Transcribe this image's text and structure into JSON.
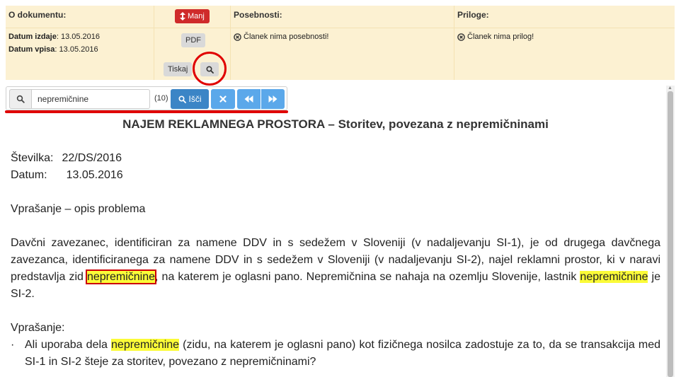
{
  "meta": {
    "about": {
      "header": "O dokumentu:",
      "issued_label": "Datum izdaje",
      "issued_value": ": 13.05.2016",
      "entered_label": "Datum vpisa",
      "entered_value": ": 13.05.2016"
    },
    "actions": {
      "less_label": "Manj",
      "pdf_label": "PDF",
      "print_label": "Tiskaj"
    },
    "specialties": {
      "header": "Posebnosti:",
      "text": "Članek nima posebnosti!"
    },
    "attachments": {
      "header": "Priloge:",
      "text": "Članek nima prilog!"
    }
  },
  "search": {
    "value": "nepremičnine",
    "count": "(10)",
    "search_label": "Išči"
  },
  "document": {
    "title": "NAJEM REKLAMNEGA PROSTORA – Storitev, povezana z nepremičninami",
    "number_label": "Številka:",
    "number_value": "22/DS/2016",
    "date_label": "Datum:",
    "date_value": "13.05.2016",
    "problem_heading": "Vprašanje – opis problema",
    "p1_part1": "Davčni zavezanec, identificiran za namene DDV in s sedežem v Sloveniji (v nadaljevanju SI-1), je od drugega davčnega zavezanca, identificiranega za namene DDV in s sedežem v Sloveniji (v nadaljevanju SI-2), najel reklamni prostor, ki v naravi predstavlja zid ",
    "p1_hl1": "nepremičnine",
    "p1_part2": ", na katerem je oglasni pano. Nepremičnina se nahaja na ozemlju Slovenije, lastnik ",
    "p1_hl2": "nepremičnine",
    "p1_part3": " je SI-2.",
    "question_heading": "Vprašanje:",
    "bullet": "·",
    "q1_part1": "Ali uporaba dela ",
    "q1_hl": "nepremičnine",
    "q1_part2": " (zidu, na katerem je oglasni pano) kot fizičnega nosilca zadostuje za to, da se transakcija med SI-1 in SI-2 šteje za storitev, povezano z nepremičninami?"
  },
  "colors": {
    "panel_bg": "#fcf1d2",
    "danger": "#cf2b2b",
    "primary": "#3b85c6",
    "highlight": "#fbfb38",
    "annotation": "#e00000"
  },
  "icons": {
    "less": "up-down-arrow-icon",
    "search": "magnifier-icon",
    "clear": "x-icon",
    "prev": "fast-backward-icon",
    "next": "fast-forward-icon",
    "info": "circle-x-icon"
  }
}
